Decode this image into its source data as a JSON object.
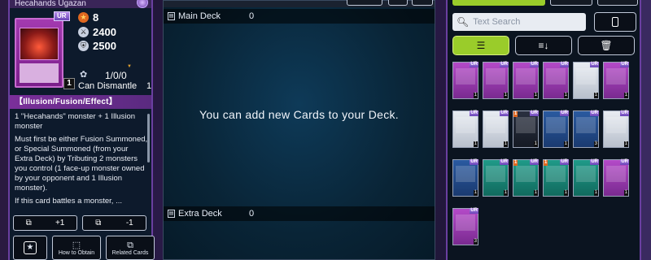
{
  "card_detail": {
    "name": "Hecahands Ugazan",
    "rarity": "UR",
    "level": "8",
    "atk": "2400",
    "def": "2500",
    "owned_count": "1",
    "craft_counts": "1/0/0",
    "dismantle_label": "Can Dismantle",
    "dismantle_count": "1",
    "type_line": "【Illusion/Fusion/Effect】",
    "description": [
      "1 \"Hecahands\" monster + 1 Illusion monster",
      "Must first be either Fusion Summoned, or Special Summoned (from your Extra Deck) by Tributing 2 monsters you control (1 face-up monster owned by your opponent and 1 Illusion monster).",
      "If this card battles a monster, ..."
    ],
    "add_label": "+1",
    "remove_label": "-1",
    "how_to_obtain_label": "How to Obtain",
    "related_cards_label": "Related Cards",
    "icons": {
      "level": "star-icon",
      "atk": "sword-icon",
      "def": "shield-icon",
      "dismantle": "dismantle-icon",
      "favorite": "favorite-star-icon"
    }
  },
  "deck": {
    "main_deck_label": "Main Deck",
    "main_deck_count": "0",
    "empty_message": "You can add new Cards to your Deck.",
    "extra_deck_label": "Extra Deck",
    "extra_deck_count": "0"
  },
  "collection": {
    "search_placeholder": "Text Search",
    "cards": [
      {
        "frame": "fusion",
        "rarity": "UR",
        "count": "1"
      },
      {
        "frame": "fusion",
        "rarity": "UR",
        "count": "1"
      },
      {
        "frame": "fusion",
        "rarity": "UR",
        "count": "1"
      },
      {
        "frame": "fusion",
        "rarity": "UR",
        "count": "1"
      },
      {
        "frame": "synchro",
        "rarity": "UR",
        "count": "1"
      },
      {
        "frame": "fusion",
        "rarity": "UR",
        "count": "1"
      },
      {
        "frame": "synchro",
        "rarity": "UR",
        "count": "1"
      },
      {
        "frame": "synchro",
        "rarity": "UR",
        "count": "1"
      },
      {
        "frame": "xyz",
        "rarity": "UR",
        "count": "1",
        "flag": "1"
      },
      {
        "frame": "link",
        "rarity": "UR",
        "count": "1"
      },
      {
        "frame": "link",
        "rarity": "UR",
        "count": "3"
      },
      {
        "frame": "synchro",
        "rarity": "UR",
        "count": "1"
      },
      {
        "frame": "link",
        "rarity": "UR",
        "count": "1"
      },
      {
        "frame": "spell",
        "rarity": "UR",
        "count": "1"
      },
      {
        "frame": "spell",
        "rarity": "UR",
        "count": "1",
        "flag": "1"
      },
      {
        "frame": "spell",
        "rarity": "UR",
        "count": "1",
        "flag": "1"
      },
      {
        "frame": "spell",
        "rarity": "UR",
        "count": "1"
      },
      {
        "frame": "fusion",
        "rarity": "UR",
        "count": "1"
      },
      {
        "frame": "fusion",
        "rarity": "UR",
        "count": "3"
      }
    ]
  },
  "colors": {
    "accent_green": "#9acc2a",
    "fusion_purple": "#7b2f9a",
    "frame_purple": "#6a3fa0"
  }
}
